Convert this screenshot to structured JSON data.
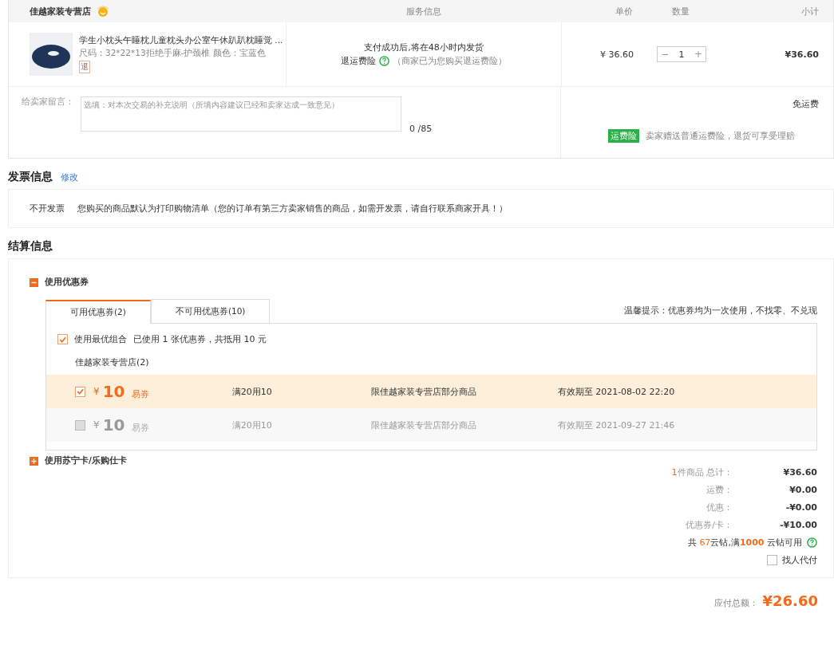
{
  "order_table": {
    "columns": [
      {
        "label": "佳越家装专营店"
      },
      {
        "label": "服务信息"
      },
      {
        "label": "单价"
      },
      {
        "label": "数量"
      },
      {
        "label": "小计"
      }
    ],
    "item": {
      "title": "学生小枕头午睡枕儿童枕头办公室午休趴趴枕睡觉 ...",
      "spec": "尺码：32*22*13拒绝手麻-护颈椎   颜色：宝蓝色",
      "tag": "退",
      "service": "支付成功后,将在48小时内发货",
      "insurance_label": "退运费险",
      "insurance_note": "（商家已为您购买退运费险）",
      "price": "¥ 36.60",
      "quantity": "1",
      "decrement": "−",
      "increment": "+",
      "subtotal": "¥36.60"
    },
    "message": {
      "label": "给卖家留言：",
      "placeholder": "选填：对本次交易的补充说明（所填内容建议已经和卖家达成一致意见）",
      "counter": "0 /85"
    },
    "shipping": {
      "fee": "免运费",
      "badge": "运费险",
      "note": "卖家赠送普通运费险，退货可享受理赔"
    }
  },
  "invoice": {
    "title": "发票信息",
    "edit_link": "修改",
    "type": "不开发票",
    "note": "您购买的商品默认为打印购物清单（您的订单有第三方卖家销售的商品，如需开发票，请自行联系商家开具！）"
  },
  "settlement": {
    "title": "结算信息",
    "coupon_section": {
      "label": "使用优惠券",
      "expanded": true,
      "tabs": [
        {
          "label": "可用优惠券(2)",
          "selected": true
        },
        {
          "label": "不可用优惠券(10)",
          "selected": false
        }
      ],
      "tip": "温馨提示：优惠券均为一次使用，不找零、不兑现",
      "best_combo": {
        "checked": true,
        "label": "使用最优组合",
        "summary": "已使用 1 张优惠券，共抵用 10 元"
      },
      "store": "佳越家装专营店(2)",
      "coupons": [
        {
          "selected": true,
          "currency": "¥",
          "amount": "10",
          "type": "易券",
          "condition": "满20用10",
          "scope": "限佳越家装专营店部分商品",
          "expiry": "有效期至 2021-08-02 22:20"
        },
        {
          "selected": false,
          "currency": "¥",
          "amount": "10",
          "type": "易券",
          "condition": "满20用10",
          "scope": "限佳越家装专营店部分商品",
          "expiry": "有效期至 2021-09-27 21:46"
        }
      ]
    },
    "card_section": {
      "label": "使用苏宁卡/乐购仕卡",
      "expanded": false
    },
    "summary": [
      {
        "count": "1",
        "label": "件商品 总计：",
        "value": "¥36.60"
      },
      {
        "label": "运费：",
        "value": "¥0.00"
      },
      {
        "label": "优惠：",
        "value": "-¥0.00"
      },
      {
        "label": "优惠券/卡：",
        "value": "-¥10.00"
      }
    ],
    "points": {
      "prefix": "共",
      "have": "67",
      "middle": "云钻,满",
      "need": "1000",
      "suffix": "云钻可用"
    },
    "pay_for_me": {
      "checked": false,
      "label": "找人代付"
    },
    "total": {
      "label": "应付总额：",
      "value": "¥26.60"
    }
  }
}
